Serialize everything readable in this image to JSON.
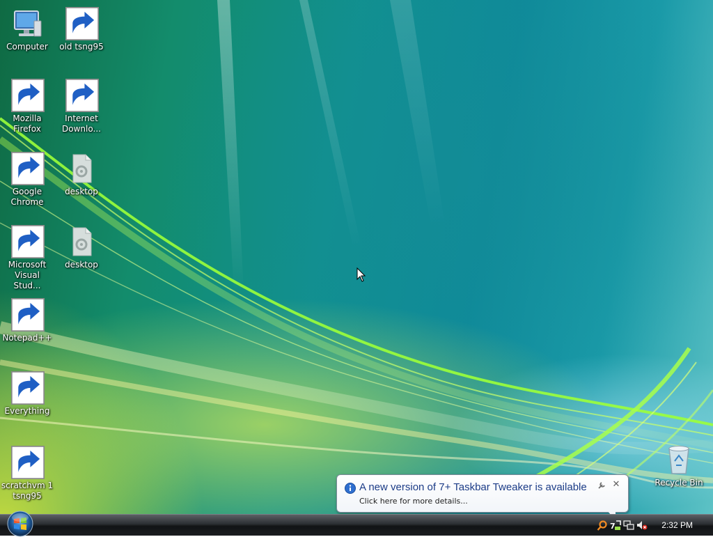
{
  "desktop": {
    "icons": [
      {
        "label": "Computer",
        "icon": "computer-icon"
      },
      {
        "label": "old tsng95",
        "icon": "shortcut-folder-icon"
      },
      {
        "label": "Mozilla Firefox",
        "icon": "firefox-icon"
      },
      {
        "label": "Internet Downlo...",
        "icon": "internet-download-manager-icon"
      },
      {
        "label": "Google Chrome",
        "icon": "chrome-icon"
      },
      {
        "label": "desktop",
        "icon": "file-icon"
      },
      {
        "label": "Microsoft Visual Stud...",
        "icon": "visual-studio-icon"
      },
      {
        "label": "desktop",
        "icon": "file-icon"
      },
      {
        "label": "Notepad++",
        "icon": "notepad-plus-plus-icon"
      },
      {
        "label": "Everything",
        "icon": "everything-search-icon"
      },
      {
        "label": "scratchvm 1 tsng95",
        "icon": "windows-logo-icon"
      },
      {
        "label": "Recycle Bin",
        "icon": "recycle-bin-icon"
      }
    ]
  },
  "notification": {
    "title": "A new version of 7+ Taskbar Tweaker is available",
    "body": "Click here for more details...",
    "icons": [
      "info-icon",
      "options-wrench-icon",
      "close-icon"
    ]
  },
  "taskbar": {
    "start_icon": "windows-start-orb-icon",
    "tray_icons": [
      "everything-tray-icon",
      "taskbar-tweaker-tray-icon",
      "network-icon",
      "volume-muted-icon"
    ],
    "clock": "2:32 PM"
  },
  "colors": {
    "balloon_title": "#1c3c87",
    "taskbar": "#1b1d20",
    "wallpaper_teal": "#11908f",
    "wallpaper_yellow": "#dce83c"
  }
}
